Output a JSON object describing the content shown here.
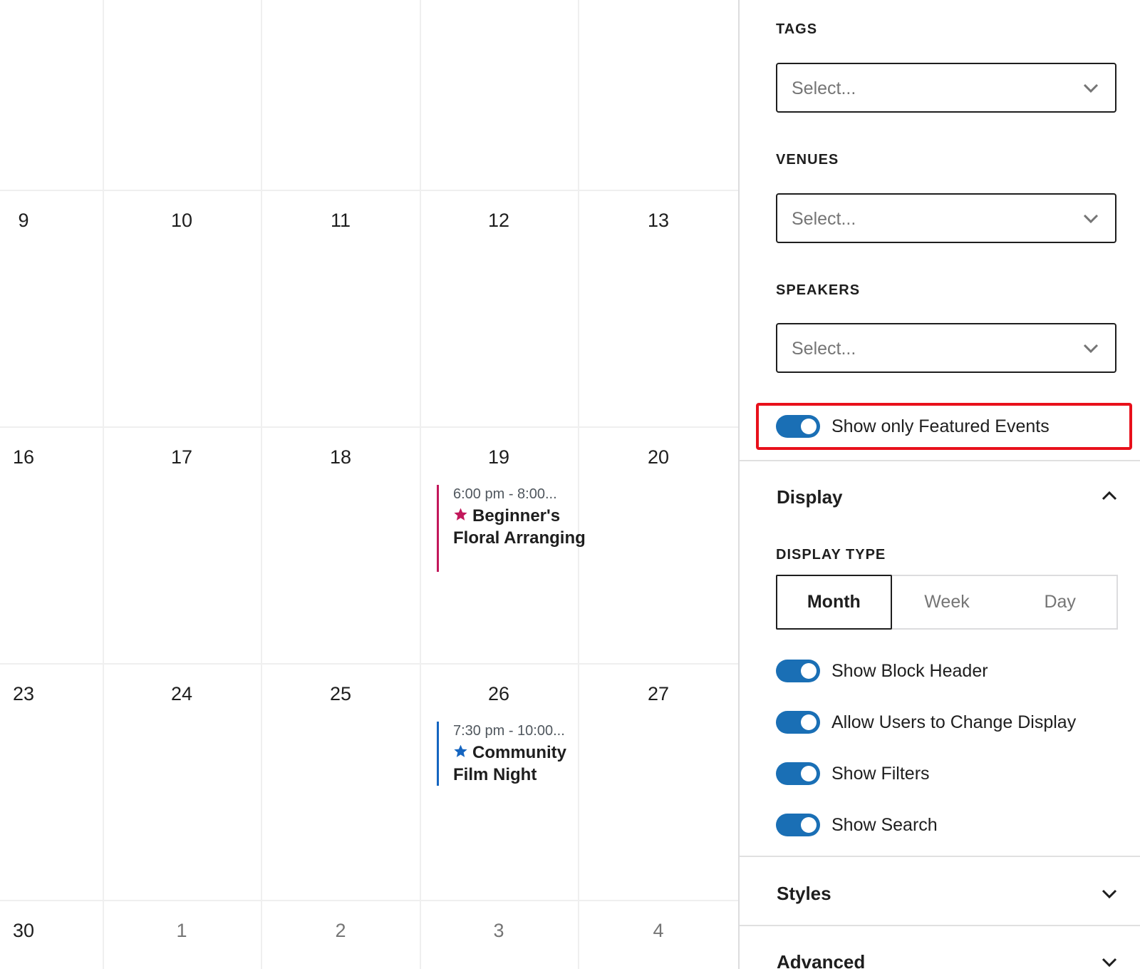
{
  "calendar": {
    "rows": [
      {
        "days": [
          {
            "num": ""
          },
          {
            "num": ""
          },
          {
            "num": ""
          },
          {
            "num": ""
          },
          {
            "num": ""
          }
        ]
      },
      {
        "days": [
          {
            "num": "9"
          },
          {
            "num": "10"
          },
          {
            "num": "11"
          },
          {
            "num": "12"
          },
          {
            "num": "13"
          }
        ]
      },
      {
        "days": [
          {
            "num": "16"
          },
          {
            "num": "17"
          },
          {
            "num": "18"
          },
          {
            "num": "19"
          },
          {
            "num": "20"
          }
        ]
      },
      {
        "days": [
          {
            "num": "23"
          },
          {
            "num": "24"
          },
          {
            "num": "25"
          },
          {
            "num": "26"
          },
          {
            "num": "27"
          }
        ]
      },
      {
        "days": [
          {
            "num": "30"
          },
          {
            "num": "1"
          },
          {
            "num": "2"
          },
          {
            "num": "3"
          },
          {
            "num": "4"
          }
        ]
      }
    ],
    "events": [
      {
        "time": "6:00 pm - 8:00...",
        "title": "Beginner's Floral Arranging",
        "color": "#c2185b"
      },
      {
        "time": "7:30 pm - 10:00...",
        "title": "Community Film Night",
        "color": "#1565c0"
      }
    ]
  },
  "sidebar": {
    "filters": {
      "tags": {
        "label": "TAGS",
        "placeholder": "Select..."
      },
      "venues": {
        "label": "VENUES",
        "placeholder": "Select..."
      },
      "speakers": {
        "label": "SPEAKERS",
        "placeholder": "Select..."
      },
      "featured_toggle": {
        "label": "Show only Featured Events",
        "checked": true
      }
    },
    "display": {
      "title": "Display",
      "type_label": "DISPLAY TYPE",
      "types": [
        "Month",
        "Week",
        "Day"
      ],
      "selected_type": "Month",
      "toggles": [
        {
          "label": "Show Block Header",
          "checked": true
        },
        {
          "label": "Allow Users to Change Display",
          "checked": true
        },
        {
          "label": "Show Filters",
          "checked": true
        },
        {
          "label": "Show Search",
          "checked": true
        }
      ]
    },
    "styles": {
      "title": "Styles"
    },
    "advanced": {
      "title": "Advanced"
    }
  },
  "colors": {
    "toggle_on": "#1a6fb5",
    "highlight": "#e8101b",
    "event_pink": "#c2185b",
    "event_blue": "#1565c0"
  }
}
